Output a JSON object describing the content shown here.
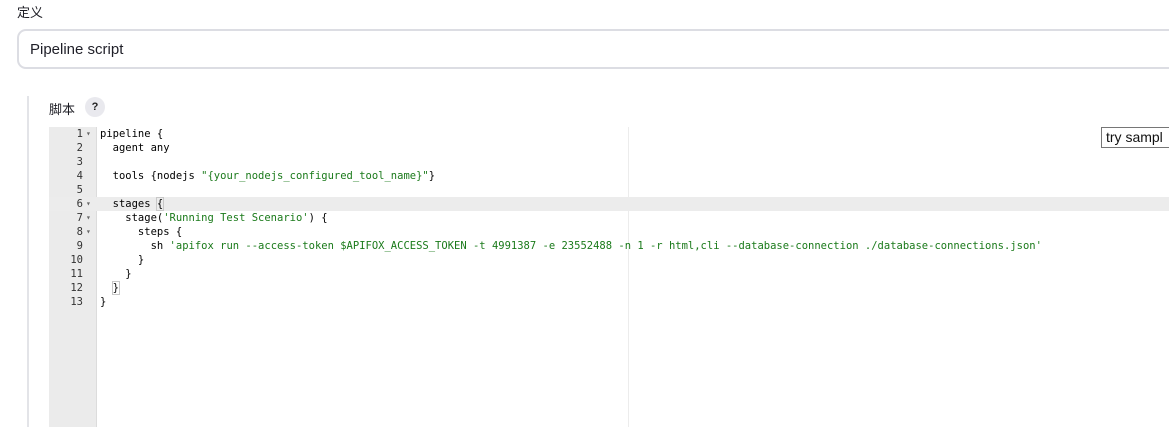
{
  "definition": {
    "label": "定义",
    "selected": "Pipeline script"
  },
  "script": {
    "label": "脚本",
    "help": "?",
    "sample_dropdown": "try sampl",
    "lines": [
      {
        "n": "1",
        "fold": "▾",
        "text": "pipeline {"
      },
      {
        "n": "2",
        "fold": "",
        "text": "  agent any"
      },
      {
        "n": "3",
        "fold": "",
        "text": ""
      },
      {
        "n": "4",
        "fold": "",
        "pre": "  tools {nodejs ",
        "str": "\"{your_nodejs_configured_tool_name}\"",
        "post": "}"
      },
      {
        "n": "5",
        "fold": "",
        "text": ""
      },
      {
        "n": "6",
        "fold": "▾",
        "pre": "  stages ",
        "hl": "{",
        "post": ""
      },
      {
        "n": "7",
        "fold": "▾",
        "pre": "    stage(",
        "str": "'Running Test Scenario'",
        "post": ") {"
      },
      {
        "n": "8",
        "fold": "▾",
        "text": "      steps {"
      },
      {
        "n": "9",
        "fold": "",
        "pre": "        sh ",
        "str": "'apifox run --access-token $APIFOX_ACCESS_TOKEN -t 4991387 -e 23552488 -n 1 -r html,cli --database-connection ./database-connections.json'",
        "post": ""
      },
      {
        "n": "10",
        "fold": "",
        "text": "      }"
      },
      {
        "n": "11",
        "fold": "",
        "text": "    }"
      },
      {
        "n": "12",
        "fold": "",
        "pre": "  ",
        "hl": "}",
        "post": ""
      },
      {
        "n": "13",
        "fold": "",
        "text": "}"
      }
    ]
  }
}
